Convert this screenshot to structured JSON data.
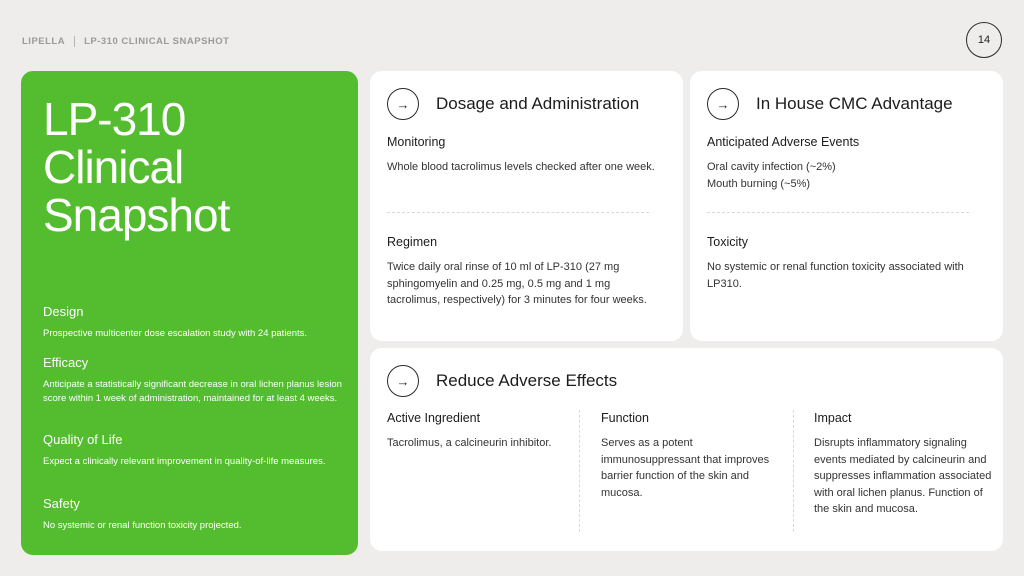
{
  "header": {
    "brand": "LIPELLA",
    "section": "LP-310 CLINICAL SNAPSHOT",
    "page_number": "14"
  },
  "left_panel": {
    "title_lines": [
      "LP-310",
      "Clinical",
      "Snapshot"
    ],
    "sections": [
      {
        "heading": "Design",
        "text": "Prospective multicenter dose escalation study with 24 patients."
      },
      {
        "heading": "Efficacy",
        "text": "Anticipate a statistically significant decrease in oral lichen planus lesion score within 1 week of administration, maintained for at least 4 weeks."
      },
      {
        "heading": "Quality of Life",
        "text": "Expect a clinically relevant improvement in quality-of-life measures."
      },
      {
        "heading": "Safety",
        "text": "No systemic or renal function toxicity projected."
      }
    ]
  },
  "dosage_card": {
    "icon": "arrow-right-icon",
    "title": "Dosage and Administration",
    "items": [
      {
        "heading": "Monitoring",
        "text": "Whole blood tacrolimus levels checked after one week."
      },
      {
        "heading": "Regimen",
        "text": "Twice daily oral rinse of 10 ml of LP-310 (27 mg sphingomyelin and 0.25 mg, 0.5 mg and 1 mg tacrolimus, respectively) for 3 minutes for four weeks."
      }
    ]
  },
  "cmc_card": {
    "icon": "arrow-right-icon",
    "title": "In House CMC Advantage",
    "items": [
      {
        "heading": "Anticipated Adverse Events",
        "text_lines": [
          "Oral cavity infection (~2%)",
          "Mouth burning (~5%)"
        ]
      },
      {
        "heading": "Toxicity",
        "text": "No systemic or renal function toxicity associated with LP310."
      }
    ]
  },
  "adverse_card": {
    "icon": "arrow-right-icon",
    "title": "Reduce Adverse Effects",
    "columns": [
      {
        "heading": "Active Ingredient",
        "text": "Tacrolimus, a calcineurin inhibitor."
      },
      {
        "heading": "Function",
        "text": "Serves as a potent immunosuppressant that improves barrier function of the skin and mucosa."
      },
      {
        "heading": "Impact",
        "text": "Disrupts inflammatory signaling events mediated by calcineurin and suppresses inflammation associated with oral lichen planus. Function of the skin and mucosa."
      }
    ]
  },
  "colors": {
    "accent_green": "#53bd2f",
    "background": "#eeedeb",
    "card": "#ffffff"
  }
}
